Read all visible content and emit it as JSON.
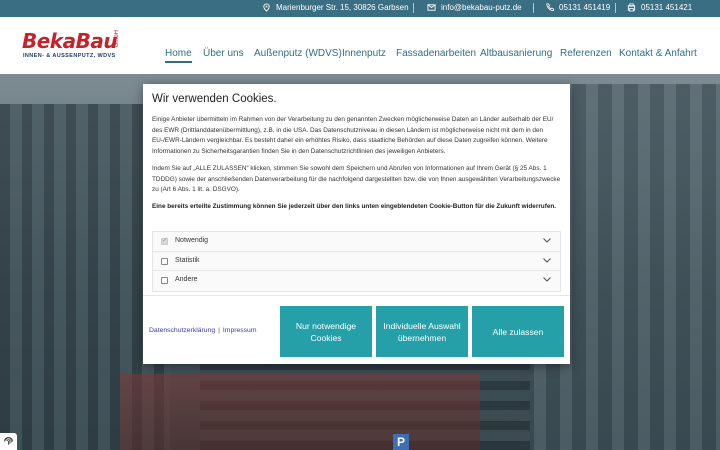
{
  "topbar": {
    "address": "Marienburger Str. 15, 30826 Garbsen",
    "email": "info@bekabau-putz.de",
    "phone1": "05131 451419",
    "phone2": "05131 451421",
    "icons": [
      "location-pin-icon",
      "mail-icon",
      "phone-icon",
      "fax-icon"
    ],
    "color": "#3a6e83"
  },
  "brand": {
    "name": "BekaBau",
    "suffix": "GmbH",
    "tagline": "INNEN- & AUSSENPUTZ, WDVS",
    "color": "#c7222a"
  },
  "nav": {
    "items": [
      {
        "label": "Home",
        "active": true
      },
      {
        "label": "Über uns",
        "active": false
      },
      {
        "label": "Außenputz (WDVS)",
        "active": false
      },
      {
        "label": "Innenputz",
        "active": false
      },
      {
        "label": "Fassadenarbeiten",
        "active": false
      },
      {
        "label": "Altbausanierung",
        "active": false
      },
      {
        "label": "Referenzen",
        "active": false
      },
      {
        "label": "Kontakt & Anfahrt",
        "active": false
      }
    ],
    "color": "#2f6f82"
  },
  "hero": {
    "sign": "P"
  },
  "cookie_modal": {
    "title": "Wir verwenden Cookies.",
    "paragraph1": "Einige Anbieter übermitteln im Rahmen von der Verarbeitung zu den genannten Zwecken möglicherweise Daten an Länder außerhalb der EU/ des EWR (Drittlanddatenübermittlung), z.B. in die USA. Das Datenschutzniveau in diesen Ländern ist möglicherweise nicht mit dem in den EU-/EWR-Ländern vergleichbar. Es besteht daher ein erhöhtes Risiko, dass staatliche Behörden auf diese Daten zugreifen können. Weitere Informationen zu Sicherheitsgarantien finden Sie in den Datenschutzrichtlinien des jeweiligen Anbieters.",
    "paragraph2": "Indem Sie auf „ALLE ZULASSEN“ klicken, stimmen Sie sowohl dem Speichern und Abrufen von Informationen auf Ihrem Gerät (§ 25 Abs. 1 TDDDG) sowie der anschließenden Datenverarbeitung für die nachfolgend dargestellten bzw. die von Ihnen ausgewählten Verarbeitungszwecke zu (Art 6 Abs. 1 lit. a. DSGVO).",
    "paragraph3": "Eine bereits erteilte Zustimmung können Sie jederzeit über den links unten eingeblendeten Cookie-Button für die Zukunft widerrufen.",
    "options": [
      {
        "label": "Notwendig",
        "checked": true,
        "disabled": true
      },
      {
        "label": "Statistik",
        "checked": false,
        "disabled": false
      },
      {
        "label": "Andere",
        "checked": false,
        "disabled": false
      }
    ],
    "links": {
      "privacy": "Datenschutzerklärung",
      "separator": "|",
      "imprint": "Impressum"
    },
    "buttons": {
      "necessary": "Nur notwendige Cookies",
      "individual": "Individuelle Auswahl übernehmen",
      "all": "Alle zulassen"
    },
    "button_color": "#25a0a8"
  },
  "cookie_button_icon": "fingerprint-icon"
}
